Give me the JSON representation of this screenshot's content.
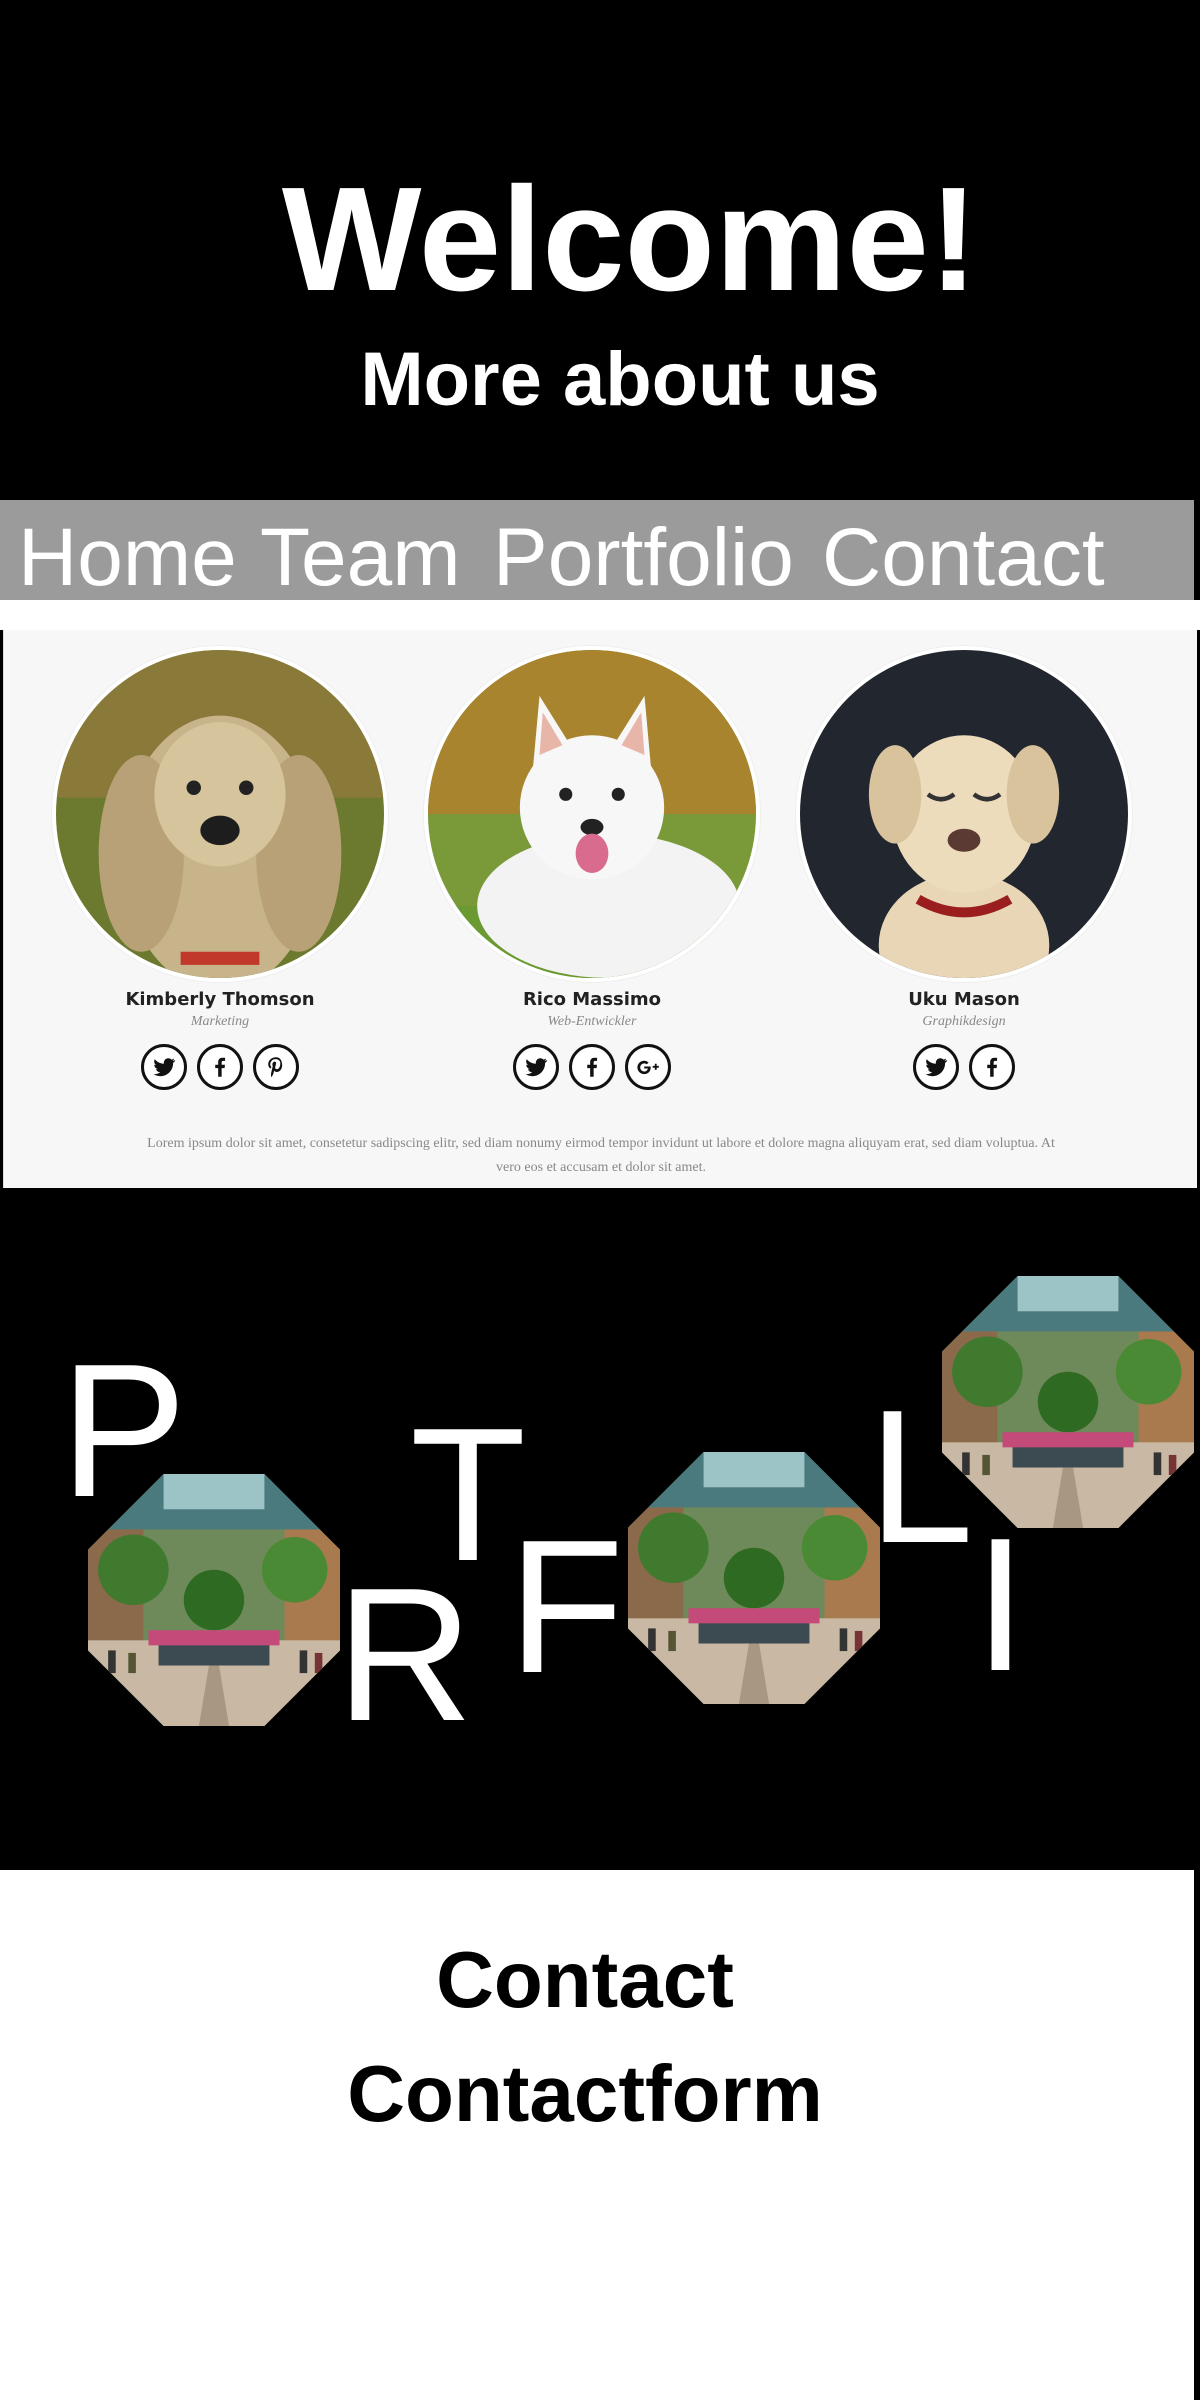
{
  "hero": {
    "title": "Welcome!",
    "subtitle": "More about us"
  },
  "nav": {
    "items": [
      {
        "label": "Home"
      },
      {
        "label": "Team"
      },
      {
        "label": "Portfolio"
      },
      {
        "label": "Contact"
      }
    ]
  },
  "team": {
    "members": [
      {
        "name": "Kimberly Thomson",
        "role": "Marketing",
        "socials": [
          "twitter-icon",
          "facebook-icon",
          "pinterest-icon"
        ]
      },
      {
        "name": "Rico Massimo",
        "role": "Web-Entwickler",
        "socials": [
          "twitter-icon",
          "facebook-icon",
          "google-plus-icon"
        ]
      },
      {
        "name": "Uku Mason",
        "role": "Graphikdesign",
        "socials": [
          "twitter-icon",
          "facebook-icon"
        ]
      }
    ],
    "text": "Lorem ipsum dolor sit amet, consetetur sadipscing elitr, sed diam nonumy eirmod tempor invidunt ut labore et dolore magna aliquyam erat, sed diam voluptua. At vero eos et accusam et dolor sit amet."
  },
  "portfolio": {
    "letters": [
      "P",
      "R",
      "T",
      "F",
      "L",
      "I"
    ]
  },
  "contact": {
    "title": "Contact",
    "subtitle": "Contactform"
  },
  "colors": {
    "background": "#000000",
    "nav_background": "#9b9b9b",
    "team_background": "#f7f7f7",
    "text_light": "#ffffff"
  }
}
